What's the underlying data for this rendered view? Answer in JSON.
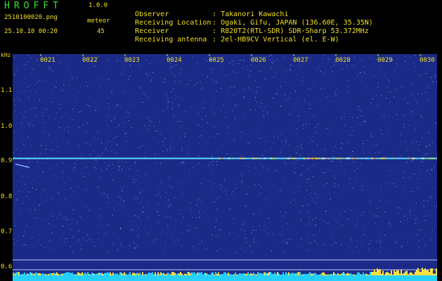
{
  "header": {
    "app_title": "HROFFT",
    "version": "1.0.0",
    "file_name": "2510100020.png",
    "meteor_label": "meteor",
    "date_time": "25.10.10 00:20",
    "meteor_count": "45"
  },
  "info": [
    {
      "key": "Observer",
      "value": ": Takanori Kawachi"
    },
    {
      "key": "Receiving Location",
      "value": ": Ogaki, Gifu, JAPAN (136.60E, 35.35N)"
    },
    {
      "key": "Receiver",
      "value": ": R820T2(RTL-SDR) SDR-Sharp 53.372MHz"
    },
    {
      "key": "Receiving antenna",
      "value": ": 2el-HB9CV Vertical (el. E-W)"
    }
  ],
  "plot": {
    "y_unit": "kHz",
    "y_ticks": [
      "1.1",
      "1.0",
      "0.9",
      "0.8",
      "0.7",
      "0.6"
    ],
    "time_ticks": [
      "0021",
      "0022",
      "0023",
      "0024",
      "0025",
      "0026",
      "0027",
      "0028",
      "0029",
      "0030"
    ],
    "carrier_khz": 0.905,
    "colors": {
      "background": "#1a2a86",
      "text": "#f0e020",
      "title": "#2ee830",
      "carrier": "#5cd8ff",
      "noise_floor": "#25d0ff"
    }
  }
}
